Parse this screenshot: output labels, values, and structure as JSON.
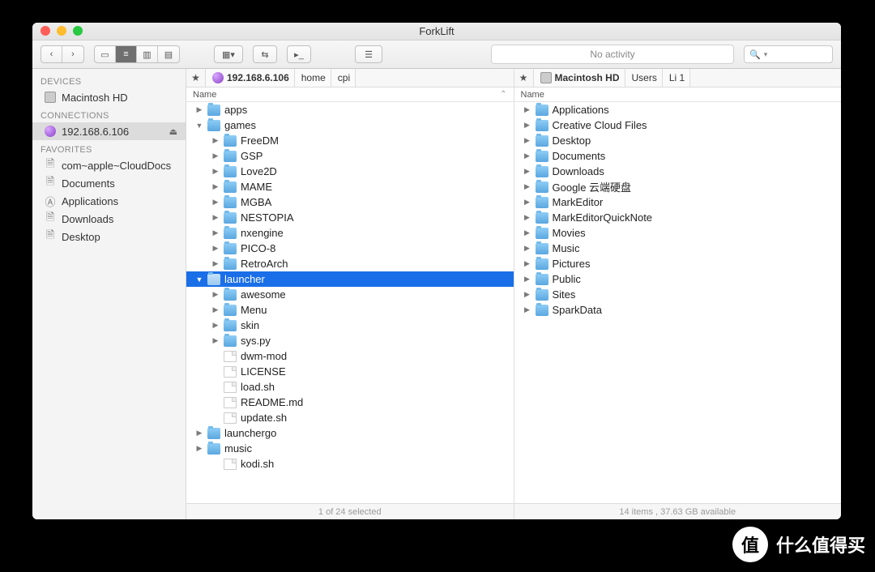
{
  "window": {
    "title": "ForkLift"
  },
  "toolbar": {
    "activity": "No activity",
    "search_placeholder": ""
  },
  "sidebar": {
    "sections": [
      {
        "header": "DEVICES",
        "items": [
          {
            "icon": "hdd",
            "label": "Macintosh HD"
          }
        ]
      },
      {
        "header": "CONNECTIONS",
        "items": [
          {
            "icon": "globe",
            "label": "192.168.6.106",
            "selected": true,
            "eject": true
          }
        ]
      },
      {
        "header": "FAVORITES",
        "items": [
          {
            "icon": "doc",
            "label": "com~apple~CloudDocs"
          },
          {
            "icon": "doc",
            "label": "Documents"
          },
          {
            "icon": "app",
            "label": "Applications"
          },
          {
            "icon": "doc",
            "label": "Downloads"
          },
          {
            "icon": "doc",
            "label": "Desktop"
          }
        ]
      }
    ]
  },
  "left_pane": {
    "path": [
      {
        "icon": "globe",
        "label": "192.168.6.106"
      },
      {
        "label": "home"
      },
      {
        "label": "cpi"
      }
    ],
    "column": "Name",
    "rows": [
      {
        "d": 0,
        "t": "folder",
        "name": "apps",
        "arrow": "right"
      },
      {
        "d": 0,
        "t": "folder",
        "name": "games",
        "arrow": "down"
      },
      {
        "d": 1,
        "t": "folder",
        "name": "FreeDM",
        "arrow": "right"
      },
      {
        "d": 1,
        "t": "folder",
        "name": "GSP",
        "arrow": "right"
      },
      {
        "d": 1,
        "t": "folder",
        "name": "Love2D",
        "arrow": "right"
      },
      {
        "d": 1,
        "t": "folder",
        "name": "MAME",
        "arrow": "right"
      },
      {
        "d": 1,
        "t": "folder",
        "name": "MGBA",
        "arrow": "right"
      },
      {
        "d": 1,
        "t": "folder",
        "name": "NESTOPIA",
        "arrow": "right"
      },
      {
        "d": 1,
        "t": "folder",
        "name": "nxengine",
        "arrow": "right"
      },
      {
        "d": 1,
        "t": "folder",
        "name": "PICO-8",
        "arrow": "right"
      },
      {
        "d": 1,
        "t": "folder",
        "name": "RetroArch",
        "arrow": "right"
      },
      {
        "d": 0,
        "t": "folder",
        "name": "launcher",
        "arrow": "down",
        "selected": true
      },
      {
        "d": 1,
        "t": "folder",
        "name": "awesome",
        "arrow": "right"
      },
      {
        "d": 1,
        "t": "folder",
        "name": "Menu",
        "arrow": "right"
      },
      {
        "d": 1,
        "t": "folder",
        "name": "skin",
        "arrow": "right"
      },
      {
        "d": 1,
        "t": "folder",
        "name": "sys.py",
        "arrow": "right"
      },
      {
        "d": 1,
        "t": "file",
        "name": "dwm-mod"
      },
      {
        "d": 1,
        "t": "file",
        "name": "LICENSE"
      },
      {
        "d": 1,
        "t": "file",
        "name": "load.sh"
      },
      {
        "d": 1,
        "t": "file",
        "name": "README.md"
      },
      {
        "d": 1,
        "t": "file",
        "name": "update.sh"
      },
      {
        "d": 0,
        "t": "folder",
        "name": "launchergo",
        "arrow": "right"
      },
      {
        "d": 0,
        "t": "folder",
        "name": "music",
        "arrow": "right"
      },
      {
        "d": 1,
        "t": "file",
        "name": "kodi.sh"
      }
    ],
    "status": "1 of 24 selected"
  },
  "right_pane": {
    "path": [
      {
        "icon": "hdd",
        "label": "Macintosh HD"
      },
      {
        "label": "Users"
      },
      {
        "label": "Li 1"
      }
    ],
    "column": "Name",
    "rows": [
      {
        "d": 0,
        "t": "folder",
        "name": "Applications",
        "arrow": "right"
      },
      {
        "d": 0,
        "t": "folder",
        "name": "Creative Cloud Files",
        "arrow": "right"
      },
      {
        "d": 0,
        "t": "folder",
        "name": "Desktop",
        "arrow": "right"
      },
      {
        "d": 0,
        "t": "folder",
        "name": "Documents",
        "arrow": "right"
      },
      {
        "d": 0,
        "t": "folder",
        "name": "Downloads",
        "arrow": "right"
      },
      {
        "d": 0,
        "t": "folder",
        "name": "Google 云端硬盘",
        "arrow": "right"
      },
      {
        "d": 0,
        "t": "folder",
        "name": "MarkEditor",
        "arrow": "right"
      },
      {
        "d": 0,
        "t": "folder",
        "name": "MarkEditorQuickNote",
        "arrow": "right"
      },
      {
        "d": 0,
        "t": "folder",
        "name": "Movies",
        "arrow": "right"
      },
      {
        "d": 0,
        "t": "folder",
        "name": "Music",
        "arrow": "right"
      },
      {
        "d": 0,
        "t": "folder",
        "name": "Pictures",
        "arrow": "right"
      },
      {
        "d": 0,
        "t": "folder",
        "name": "Public",
        "arrow": "right"
      },
      {
        "d": 0,
        "t": "folder",
        "name": "Sites",
        "arrow": "right"
      },
      {
        "d": 0,
        "t": "folder",
        "name": "SparkData",
        "arrow": "right"
      }
    ],
    "status": "14 items , 37.63 GB available"
  },
  "watermark": {
    "badge": "值",
    "text": "什么值得买"
  }
}
